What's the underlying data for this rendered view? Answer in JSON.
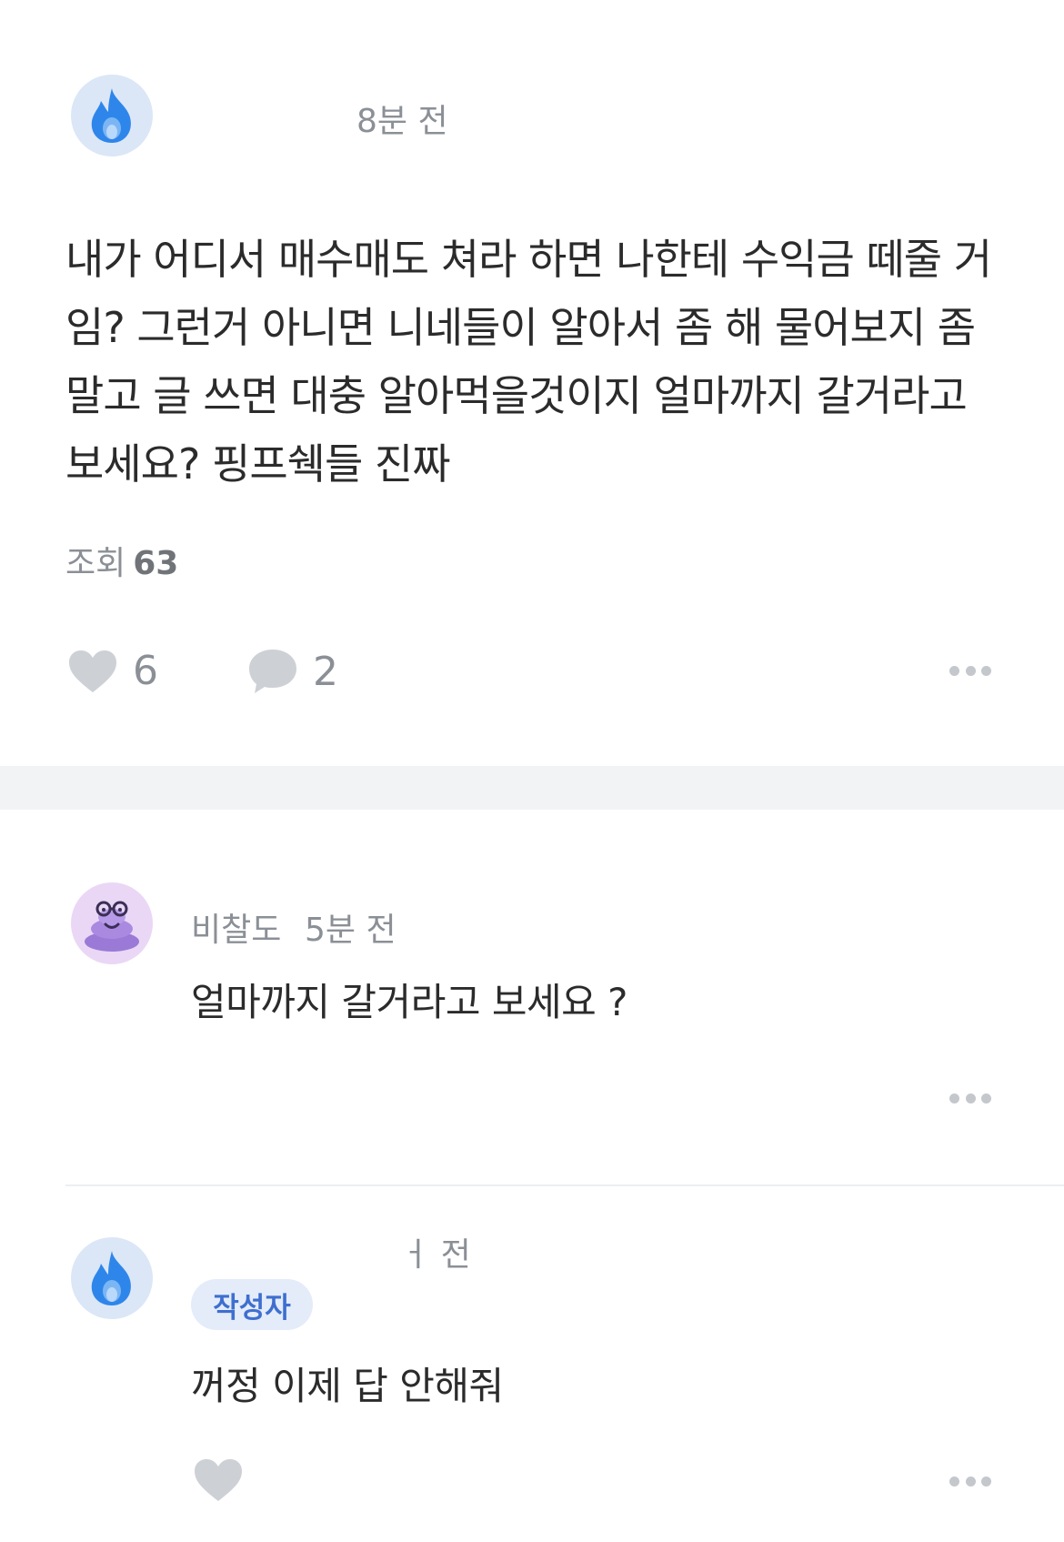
{
  "post": {
    "time": "8분 전",
    "body": "내가 어디서 매수매도 쳐라 하면 나한테 수익금 떼줄 거임? 그런거 아니면 니네들이 알아서 좀 해 물어보지 좀 말고 글 쓰면 대충 알아먹을것이지 얼마까지 갈거라고 보세요? 핑프쉑들 진짜",
    "views_label": "조회",
    "views_count": "63",
    "likes": "6",
    "comments": "2"
  },
  "comments": [
    {
      "author": "비찰도",
      "time": "5분 전",
      "text": "얼마까지 갈거라고 보세요 ?"
    },
    {
      "author": "",
      "time": "ㅓ 전",
      "badge": "작성자",
      "text": "꺼정 이제 답 안해줘"
    }
  ],
  "icons": {
    "author_avatar": "fire-icon",
    "commenter_avatar": "poop-with-glasses-icon",
    "like": "heart-icon",
    "comment": "speech-bubble-icon",
    "more": "more-dots-icon"
  },
  "colors": {
    "fire_blue": "#2f86ea",
    "badge_blue": "#3e6fcf",
    "icon_grey": "#cdd0d5"
  }
}
